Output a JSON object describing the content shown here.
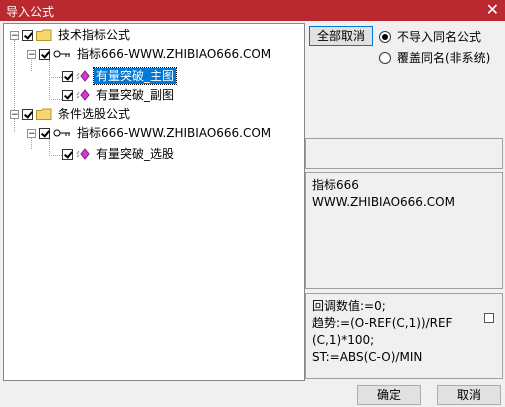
{
  "window": {
    "title": "导入公式",
    "close_glyph": "✕"
  },
  "tree": {
    "groups": [
      {
        "label": "技术指标公式",
        "child": {
          "label": "指标666-WWW.ZHIBIAO666.COM",
          "items": [
            "有量突破_主图",
            "有量突破_副图"
          ]
        }
      },
      {
        "label": "条件选股公式",
        "child": {
          "label": "指标666-WWW.ZHIBIAO666.COM",
          "items": [
            "有量突破_选股"
          ]
        }
      }
    ],
    "expander_minus": "−"
  },
  "options": {
    "cancel_all_label": "全部取消",
    "radio_no_import_label": "不导入同名公式",
    "radio_overwrite_label": "覆盖同名(非系统)",
    "selected": "不导入同名公式"
  },
  "info": {
    "line1": "指标666",
    "line2": "WWW.ZHIBIAO666.COM"
  },
  "code": {
    "lines": [
      "回调数值:=0;",
      "趋势:=(O-REF(C,1))/REF",
      "(C,1)*100;",
      "ST:=ABS(C-O)/MIN"
    ]
  },
  "footer": {
    "ok_label": "确定",
    "cancel_label": "取消"
  },
  "colors": {
    "titlebar": "#b9292f",
    "selection": "#0078d7"
  }
}
